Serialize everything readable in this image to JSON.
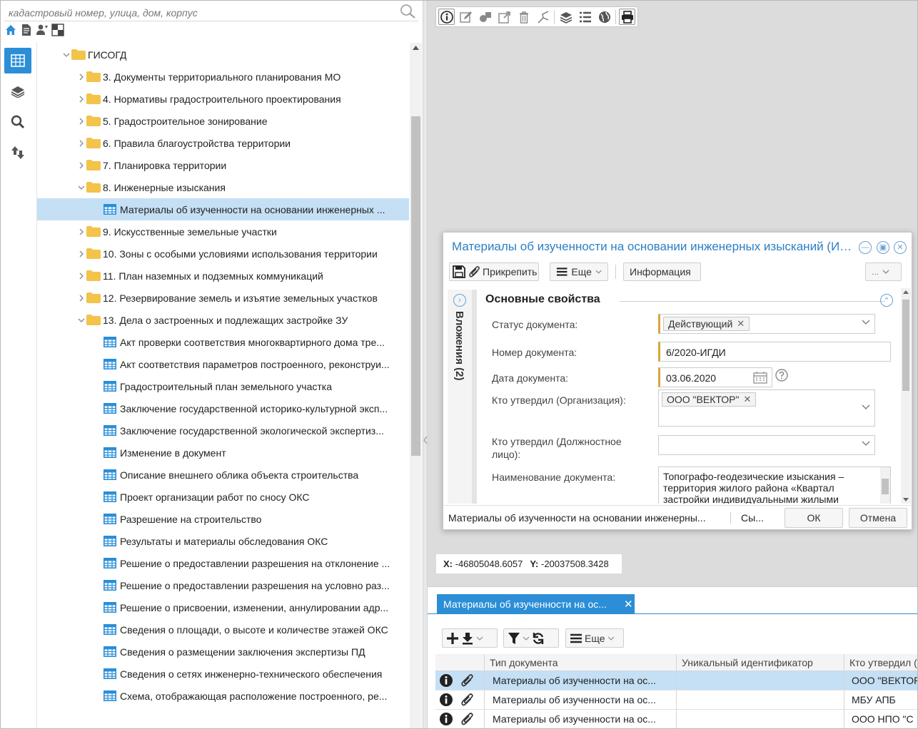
{
  "search": {
    "placeholder": "кадастровый номер, улица, дом, корпус"
  },
  "quick_icons": [
    "home-icon",
    "document-icon",
    "user-location-icon",
    "grid-pattern-icon"
  ],
  "rail": [
    "table-view-icon",
    "layers-icon",
    "search-icon",
    "sort-arrows-icon"
  ],
  "tree": {
    "root": "ГИСОГД",
    "nodes": [
      {
        "label": "3. Документы территориального планирования МО",
        "type": "folder",
        "expanded": false
      },
      {
        "label": "4. Нормативы градостроительного проектирования",
        "type": "folder",
        "expanded": false
      },
      {
        "label": "5. Градостроительное зонирование",
        "type": "folder",
        "expanded": false
      },
      {
        "label": "6. Правила благоустройства территории",
        "type": "folder",
        "expanded": false
      },
      {
        "label": "7. Планировка территории",
        "type": "folder",
        "expanded": false
      },
      {
        "label": "8. Инженерные изыскания",
        "type": "folder",
        "expanded": true
      },
      {
        "label": "Материалы об изученности на основании инженерных ...",
        "type": "table",
        "selected": true
      },
      {
        "label": "9. Искусственные земельные участки",
        "type": "folder",
        "expanded": false
      },
      {
        "label": "10. Зоны с особыми условиями использования территории",
        "type": "folder",
        "expanded": false
      },
      {
        "label": "11. План наземных и подземных коммуникаций",
        "type": "folder",
        "expanded": false
      },
      {
        "label": "12. Резервирование земель и изъятие земельных участков",
        "type": "folder",
        "expanded": false
      },
      {
        "label": "13. Дела о застроенных и подлежащих застройке ЗУ",
        "type": "folder",
        "expanded": true
      },
      {
        "label": "Акт проверки соответствия многоквартирного дома тре...",
        "type": "table"
      },
      {
        "label": "Акт соответствия параметров построенного, реконструи...",
        "type": "table"
      },
      {
        "label": "Градостроительный план земельного участка",
        "type": "table"
      },
      {
        "label": "Заключение государственной историко-культурной эксп...",
        "type": "table"
      },
      {
        "label": "Заключение государственной экологической экспертиз...",
        "type": "table"
      },
      {
        "label": "Изменение в документ",
        "type": "table"
      },
      {
        "label": "Описание внешнего облика объекта строительства",
        "type": "table"
      },
      {
        "label": "Проект организации работ по сносу ОКС",
        "type": "table"
      },
      {
        "label": "Разрешение на строительство",
        "type": "table"
      },
      {
        "label": "Результаты и материалы обследования ОКС",
        "type": "table"
      },
      {
        "label": "Решение о предоставлении разрешения на отклонение ...",
        "type": "table"
      },
      {
        "label": "Решение о предоставлении разрешения на условно раз...",
        "type": "table"
      },
      {
        "label": "Решение о присвоении, изменении, аннулировании адр...",
        "type": "table"
      },
      {
        "label": "Сведения о площади, о высоте и количестве этажей ОКС",
        "type": "table"
      },
      {
        "label": "Сведения о размещении заключения экспертизы ПД",
        "type": "table"
      },
      {
        "label": "Сведения о сетях инженерно-технического обеспечения",
        "type": "table"
      },
      {
        "label": "Схема, отображающая расположение построенного, ре...",
        "type": "table"
      }
    ]
  },
  "map_toolbar": [
    "info-icon",
    "edit-icon",
    "shapes-icon",
    "external-link-icon",
    "trash-icon",
    "measure-icon",
    "layers-icon",
    "list-icon",
    "globe-icon",
    "printer-icon"
  ],
  "coords": {
    "x_label": "X:",
    "x_value": "-46805048.6057",
    "y_label": "Y:",
    "y_value": "-20037508.3428"
  },
  "dialog": {
    "title": "Материалы об изученности на основании инженерных изысканий (Ин...",
    "toolbar": {
      "attach": "Прикрепить",
      "more": "Еще",
      "info": "Информация",
      "overflow": "..."
    },
    "side_tab": "Вложения (2)",
    "section": "Основные свойства",
    "fields": {
      "status_label": "Статус документа:",
      "status_value": "Действующий",
      "number_label": "Номер документа:",
      "number_value": "6/2020-ИГДИ",
      "date_label": "Дата документа:",
      "date_value": "03.06.2020",
      "org_label": "Кто утвердил (Организация):",
      "org_value": "ООО \"ВЕКТОР\"",
      "person_label": "Кто утвердил (Должностное лицо):",
      "name_label": "Наименование документа:",
      "name_value": "Топографо-геодезические изыскания – территория жилого района «Квартал застройки индивидуальными жилыми"
    },
    "footer": {
      "name": "Материалы об изученности на основании инженерны...",
      "short": "Сы...",
      "ok": "ОК",
      "cancel": "Отмена"
    }
  },
  "bottom": {
    "tab": "Материалы об изученности на ос...",
    "toolbar": {
      "more": "Еще"
    },
    "columns": [
      "Тип документа",
      "Уникальный идентификатор",
      "Кто утвердил (О"
    ],
    "rows": [
      {
        "type": "Материалы об изученности на ос...",
        "id": "",
        "org": "ООО \"ВЕКТОР\"",
        "selected": true
      },
      {
        "type": "Материалы об изученности на ос...",
        "id": "",
        "org": "МБУ АПБ",
        "selected": false
      },
      {
        "type": "Материалы об изученности на ос...",
        "id": "",
        "org": "ООО НПО \"С",
        "selected": false
      }
    ]
  },
  "colors": {
    "accent": "#2b8ed6",
    "selection": "#c5e0f5",
    "folder": "#f3c34a",
    "title": "#2b7fc4",
    "required": "#d6a73c"
  }
}
